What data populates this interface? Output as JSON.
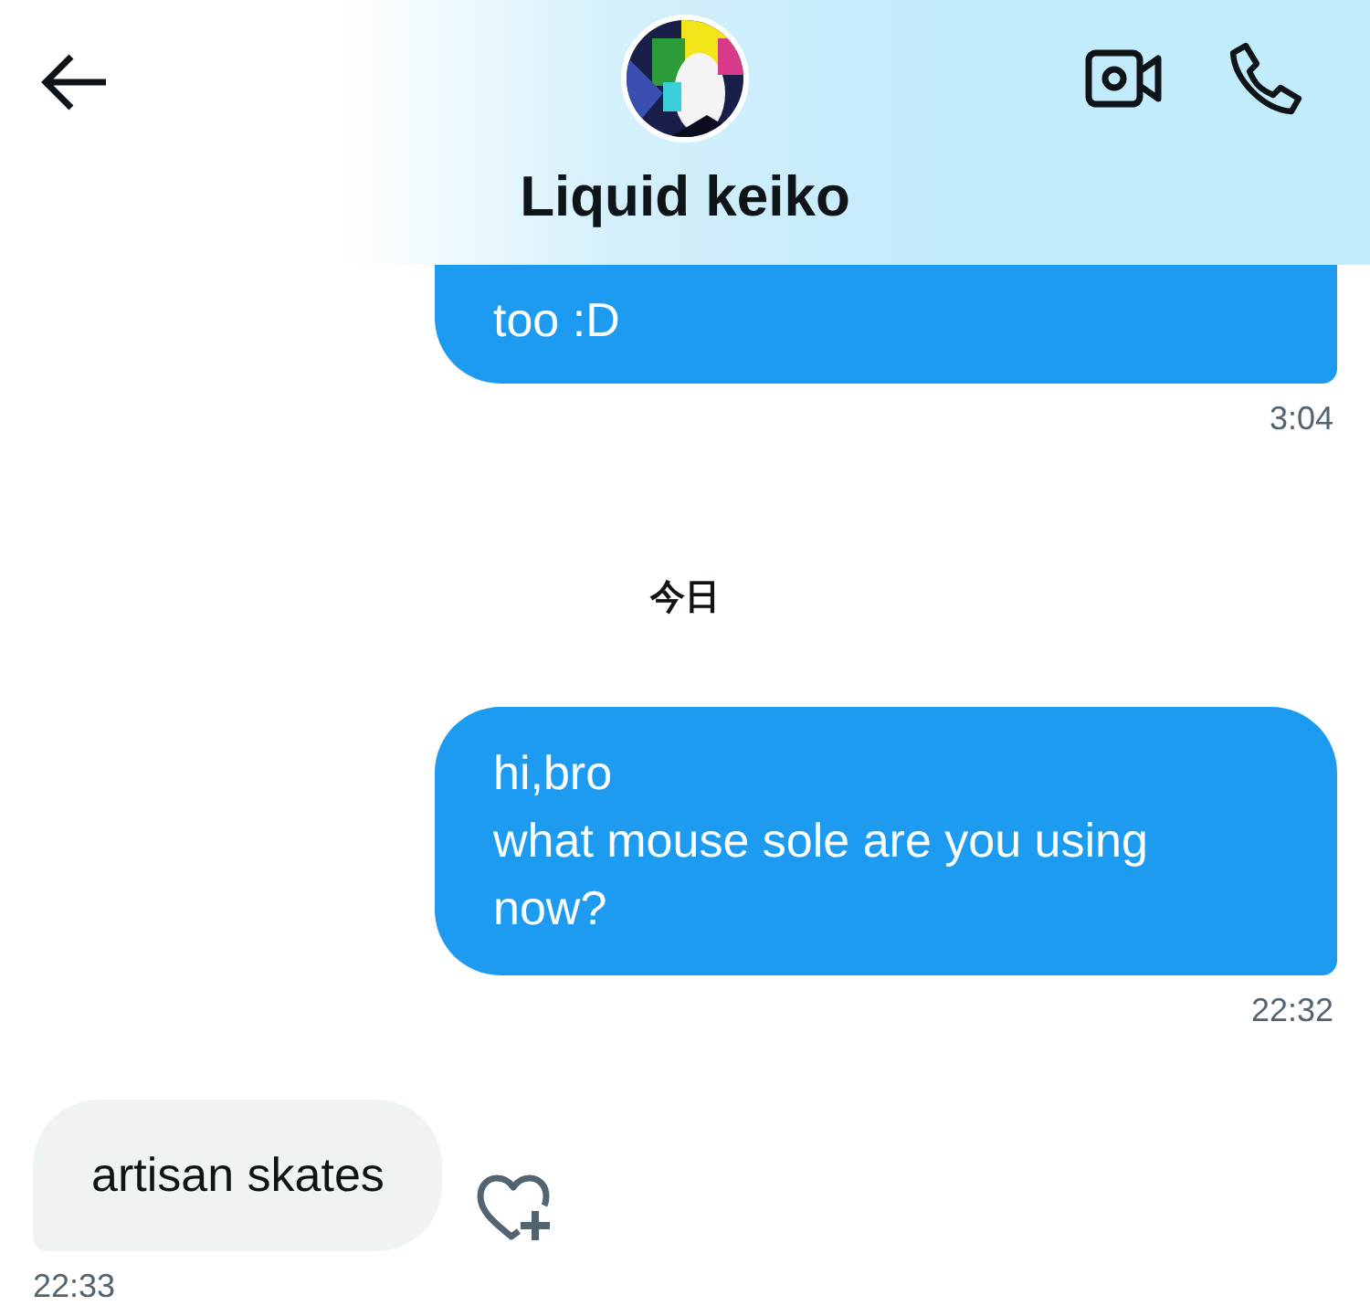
{
  "header": {
    "title": "Liquid keiko"
  },
  "messages": [
    {
      "kind": "sent",
      "lines": [
        "too :D"
      ],
      "time": "3:04",
      "clipped": true
    },
    {
      "kind": "divider",
      "label": "今日"
    },
    {
      "kind": "sent",
      "lines": [
        "hi,bro",
        "what mouse sole are you using now?"
      ],
      "time": "22:32",
      "clipped": false
    },
    {
      "kind": "received",
      "lines": [
        "artisan skates"
      ],
      "time": "22:33"
    }
  ]
}
